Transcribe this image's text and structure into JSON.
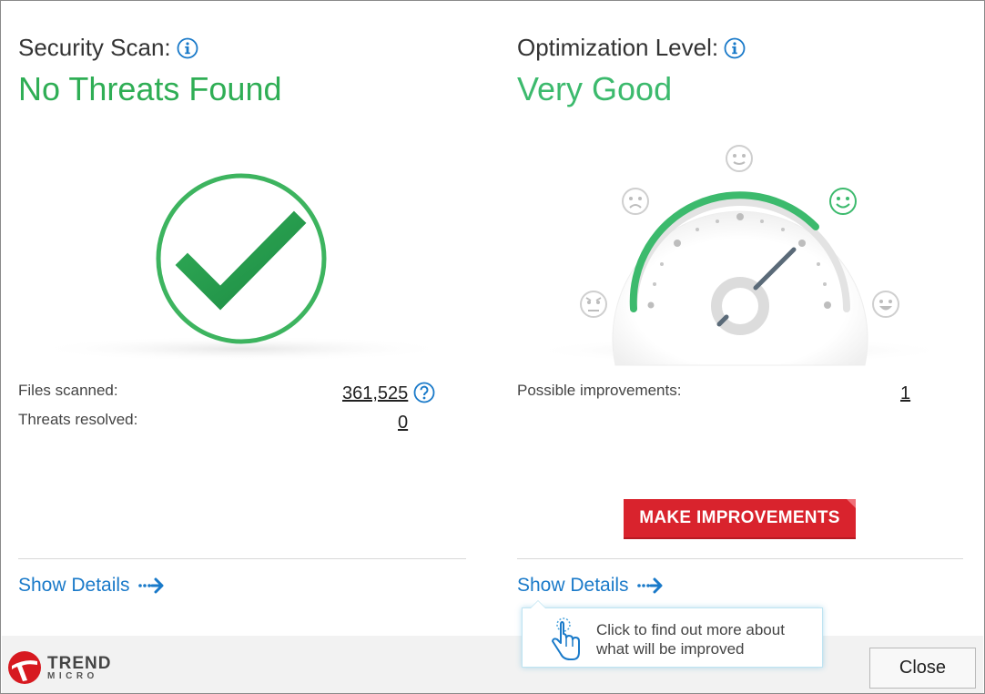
{
  "security": {
    "heading": "Security Scan:",
    "status": "No Threats Found",
    "stats": [
      {
        "label": "Files scanned:",
        "value": "361,525"
      },
      {
        "label": "Threats resolved:",
        "value": "0"
      }
    ],
    "show_details": "Show Details"
  },
  "optimization": {
    "heading": "Optimization Level:",
    "status": "Very Good",
    "stats": [
      {
        "label": "Possible improvements:",
        "value": "1"
      }
    ],
    "make_improvements": "MAKE IMPROVEMENTS",
    "show_details": "Show Details",
    "gauge_level": 0.78
  },
  "tooltip": {
    "line1": "Click to find out more about",
    "line2": "what will be improved"
  },
  "footer": {
    "logo_line1": "TREND",
    "logo_line2": "MICRO",
    "close_label": "Close"
  },
  "colors": {
    "status_green": "#2fae55",
    "link_blue": "#1a7ac9",
    "button_red": "#d9232d",
    "gauge_green": "#3cba6d"
  }
}
